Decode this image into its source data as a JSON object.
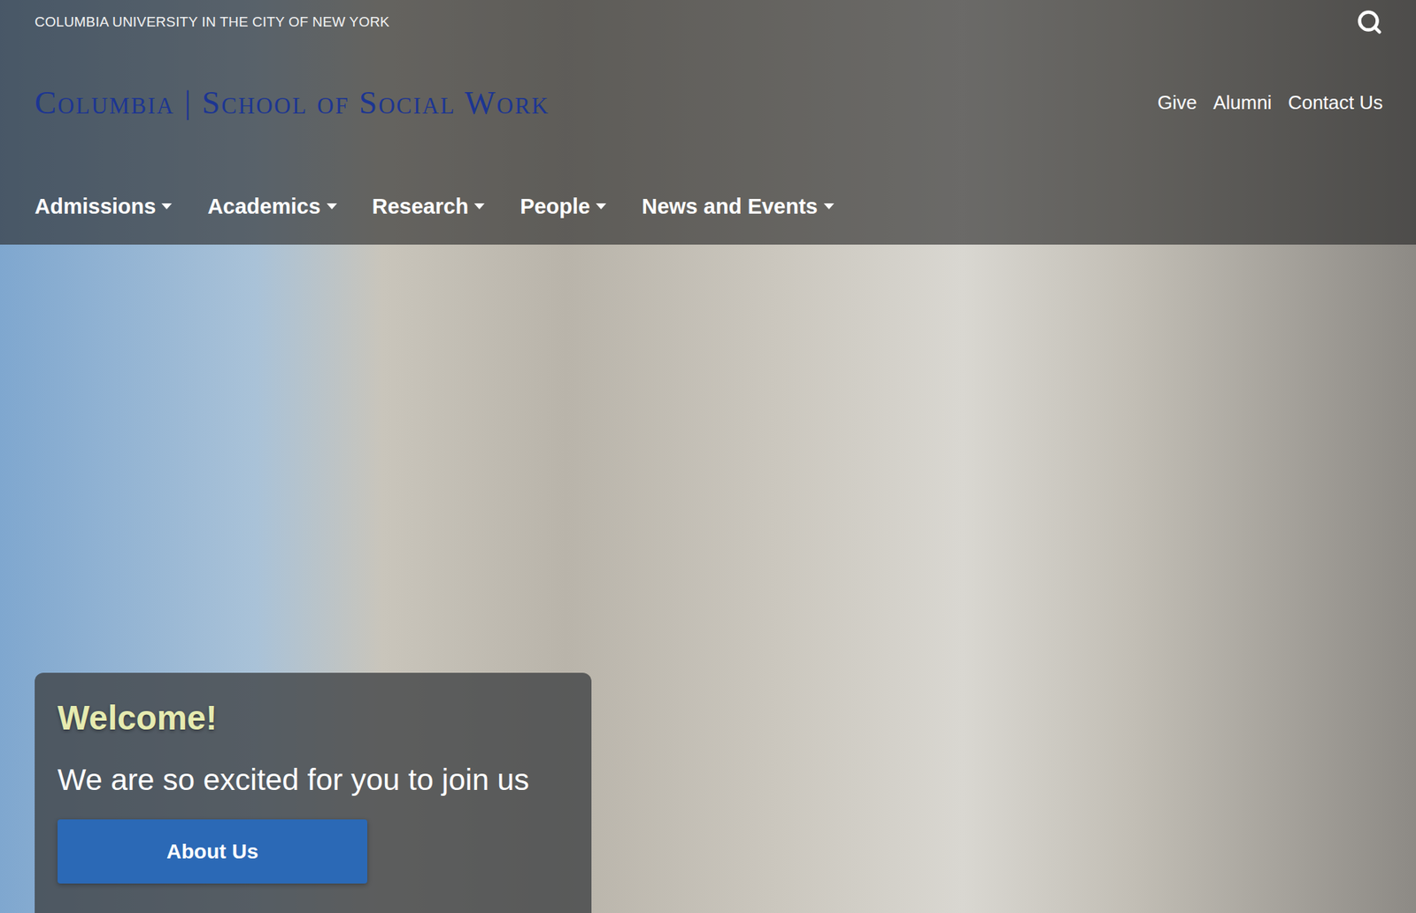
{
  "top_bar": {
    "university": "COLUMBIA UNIVERSITY IN THE CITY OF NEW YORK"
  },
  "logo": {
    "text": "Columbia | School of Social Work"
  },
  "utility_links": [
    "Give",
    "Alumni",
    "Contact Us"
  ],
  "nav": [
    {
      "label": "Admissions"
    },
    {
      "label": "Academics"
    },
    {
      "label": "Research"
    },
    {
      "label": "People"
    },
    {
      "label": "News and Events"
    }
  ],
  "welcome_card": {
    "title": "Welcome!",
    "subtitle": "We are so excited for you to join us",
    "button": "About Us"
  }
}
